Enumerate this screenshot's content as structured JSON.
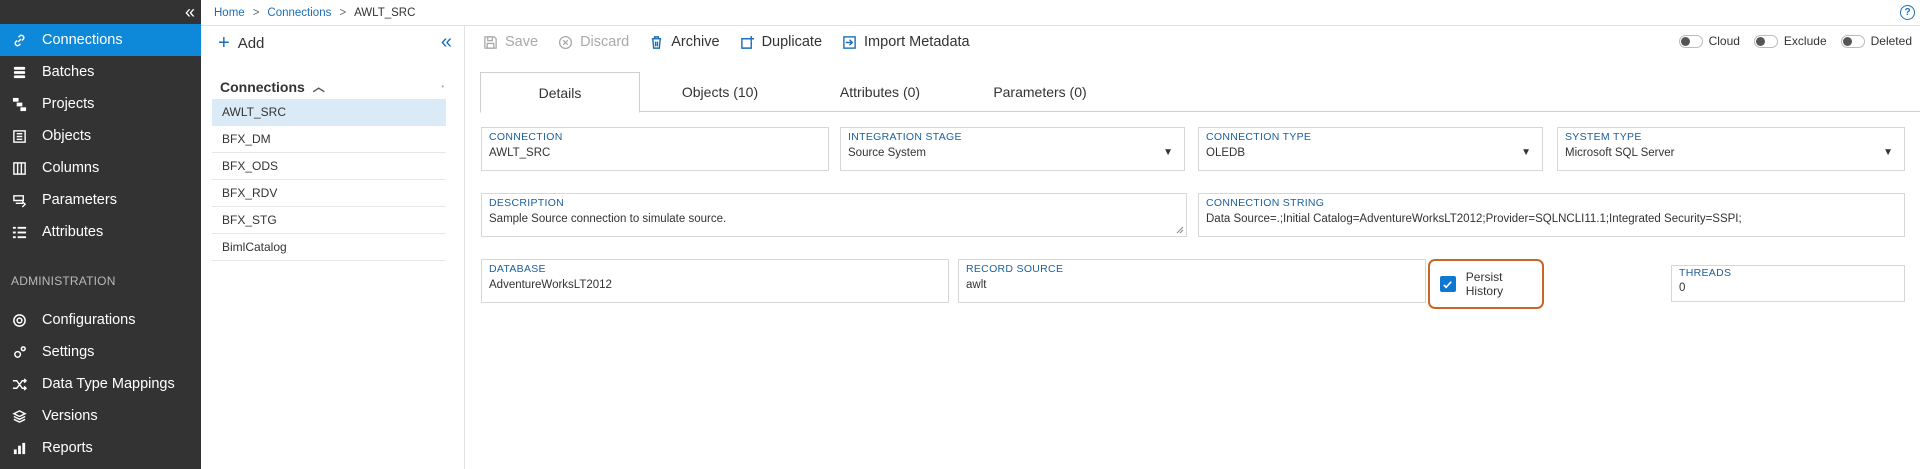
{
  "nav": {
    "items": [
      {
        "label": "Connections",
        "icon": "link-icon",
        "active": true
      },
      {
        "label": "Batches",
        "icon": "batches-icon"
      },
      {
        "label": "Projects",
        "icon": "projects-icon"
      },
      {
        "label": "Objects",
        "icon": "objects-icon"
      },
      {
        "label": "Columns",
        "icon": "columns-icon"
      },
      {
        "label": "Parameters",
        "icon": "parameters-icon"
      },
      {
        "label": "Attributes",
        "icon": "attributes-icon"
      }
    ],
    "section_label": "ADMINISTRATION",
    "admin_items": [
      {
        "label": "Configurations",
        "icon": "configurations-icon"
      },
      {
        "label": "Settings",
        "icon": "settings-icon"
      },
      {
        "label": "Data Type Mappings",
        "icon": "shuffle-icon"
      },
      {
        "label": "Versions",
        "icon": "versions-icon"
      },
      {
        "label": "Reports",
        "icon": "reports-icon"
      }
    ]
  },
  "breadcrumb": {
    "home": "Home",
    "section": "Connections",
    "current": "AWLT_SRC",
    "separator": ">"
  },
  "help_label": "?",
  "list": {
    "add_label": "Add",
    "header": "Connections",
    "items": [
      "AWLT_SRC",
      "BFX_DM",
      "BFX_ODS",
      "BFX_RDV",
      "BFX_STG",
      "BimlCatalog"
    ],
    "selected": "AWLT_SRC"
  },
  "toolbar": {
    "save": "Save",
    "discard": "Discard",
    "archive": "Archive",
    "duplicate": "Duplicate",
    "import_metadata": "Import Metadata",
    "toggles": [
      "Cloud",
      "Exclude",
      "Deleted"
    ]
  },
  "tabs": [
    "Details",
    "Objects (10)",
    "Attributes (0)",
    "Parameters (0)"
  ],
  "form": {
    "connection": {
      "label": "CONNECTION",
      "value": "AWLT_SRC"
    },
    "integration_stage": {
      "label": "INTEGRATION STAGE",
      "value": "Source System"
    },
    "connection_type": {
      "label": "CONNECTION TYPE",
      "value": "OLEDB"
    },
    "system_type": {
      "label": "SYSTEM TYPE",
      "value": "Microsoft SQL Server"
    },
    "description": {
      "label": "DESCRIPTION",
      "value": "Sample Source connection to simulate source."
    },
    "connection_string": {
      "label": "CONNECTION STRING",
      "value": "Data Source=.;Initial Catalog=AdventureWorksLT2012;Provider=SQLNCLI11.1;Integrated Security=SSPI;"
    },
    "database": {
      "label": "DATABASE",
      "value": "AdventureWorksLT2012"
    },
    "record_source": {
      "label": "RECORD SOURCE",
      "value": "awlt"
    },
    "persist_history": {
      "label": "Persist History",
      "checked": true
    },
    "threads": {
      "label": "THREADS",
      "value": "0"
    }
  },
  "colors": {
    "nav_bg": "#333333",
    "accent": "#0e88d8",
    "link": "#1b6fb8",
    "highlight_border": "#c8662a",
    "label": "#1b5f9e"
  }
}
